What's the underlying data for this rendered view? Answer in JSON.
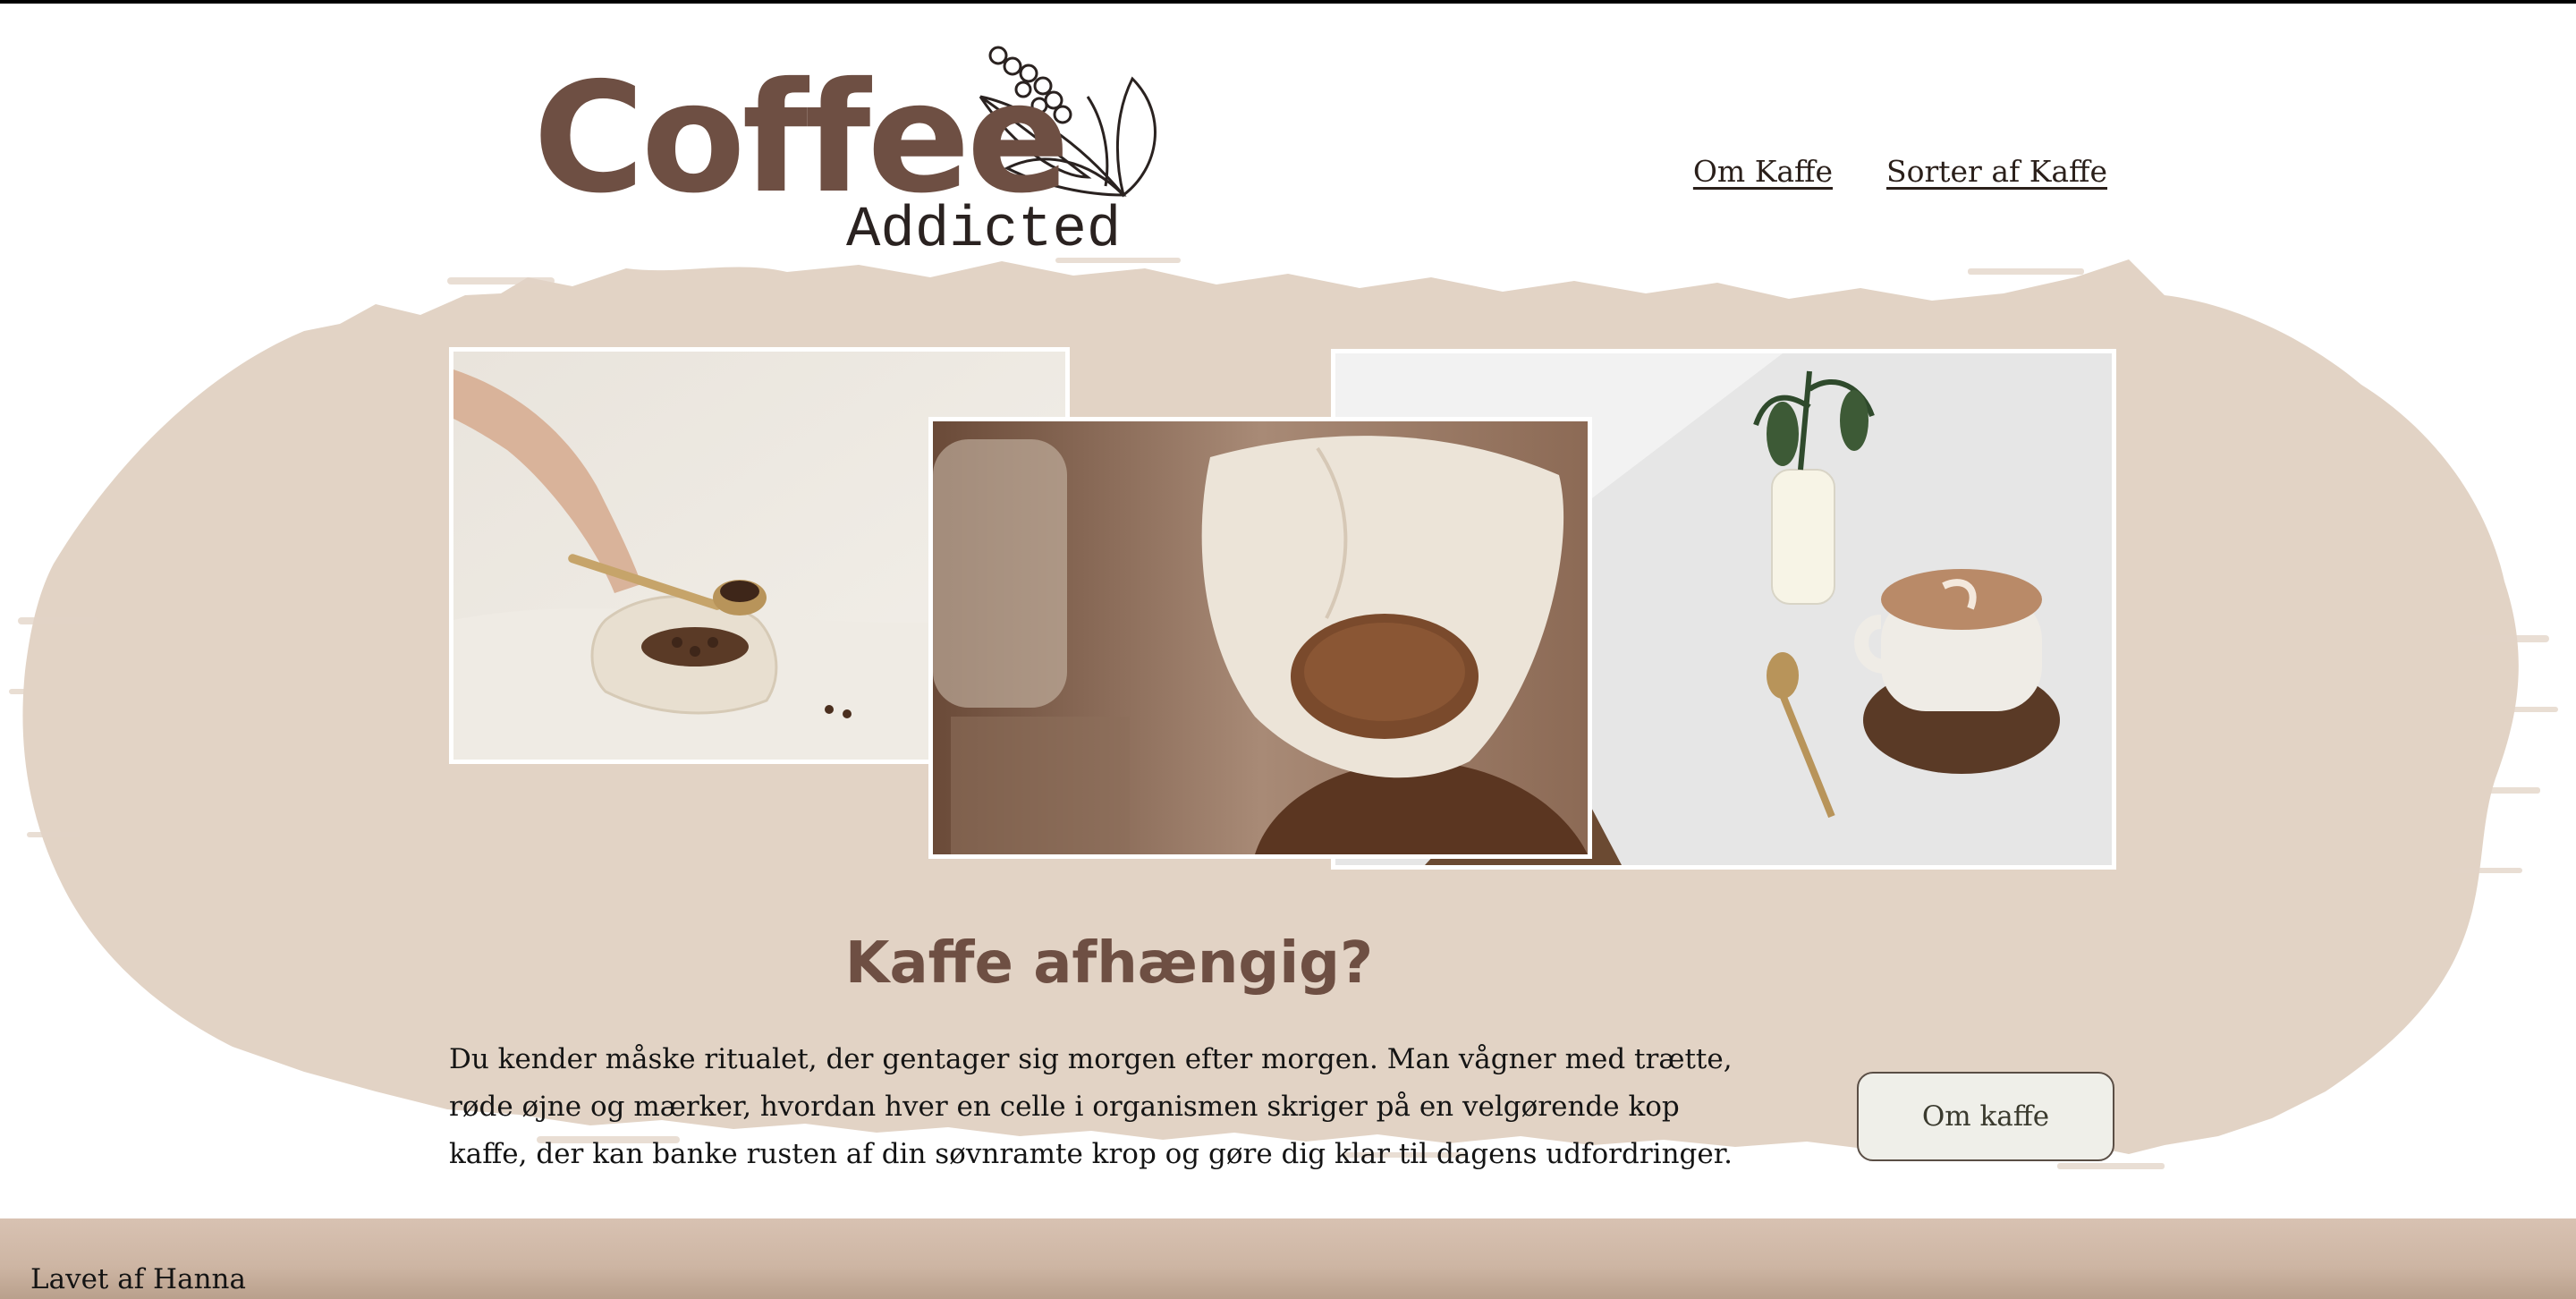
{
  "brand": {
    "logo_word": "Coffee",
    "logo_sub": "Addicted"
  },
  "nav": {
    "items": [
      {
        "label": "Om Kaffe"
      },
      {
        "label": "Sorter af Kaffe"
      }
    ]
  },
  "hero": {
    "heading": "Kaffe afhængig?",
    "intro": "Du kender måske ritualet, der gentager sig morgen efter morgen. Man vågner med trætte, røde øjne og mærker, hvordan hver en celle i organismen skriger på en velgørende kop kaffe, der kan banke rusten af din søvnramte krop og gøre dig klar til dagens udfordringer.",
    "cta_label": "Om kaffe"
  },
  "footer": {
    "text": "Lavet af Hanna"
  },
  "colors": {
    "brand_brown": "#6e4f43",
    "brush_beige": "#e2d3c5",
    "footer_beige": "#d2bcab"
  }
}
